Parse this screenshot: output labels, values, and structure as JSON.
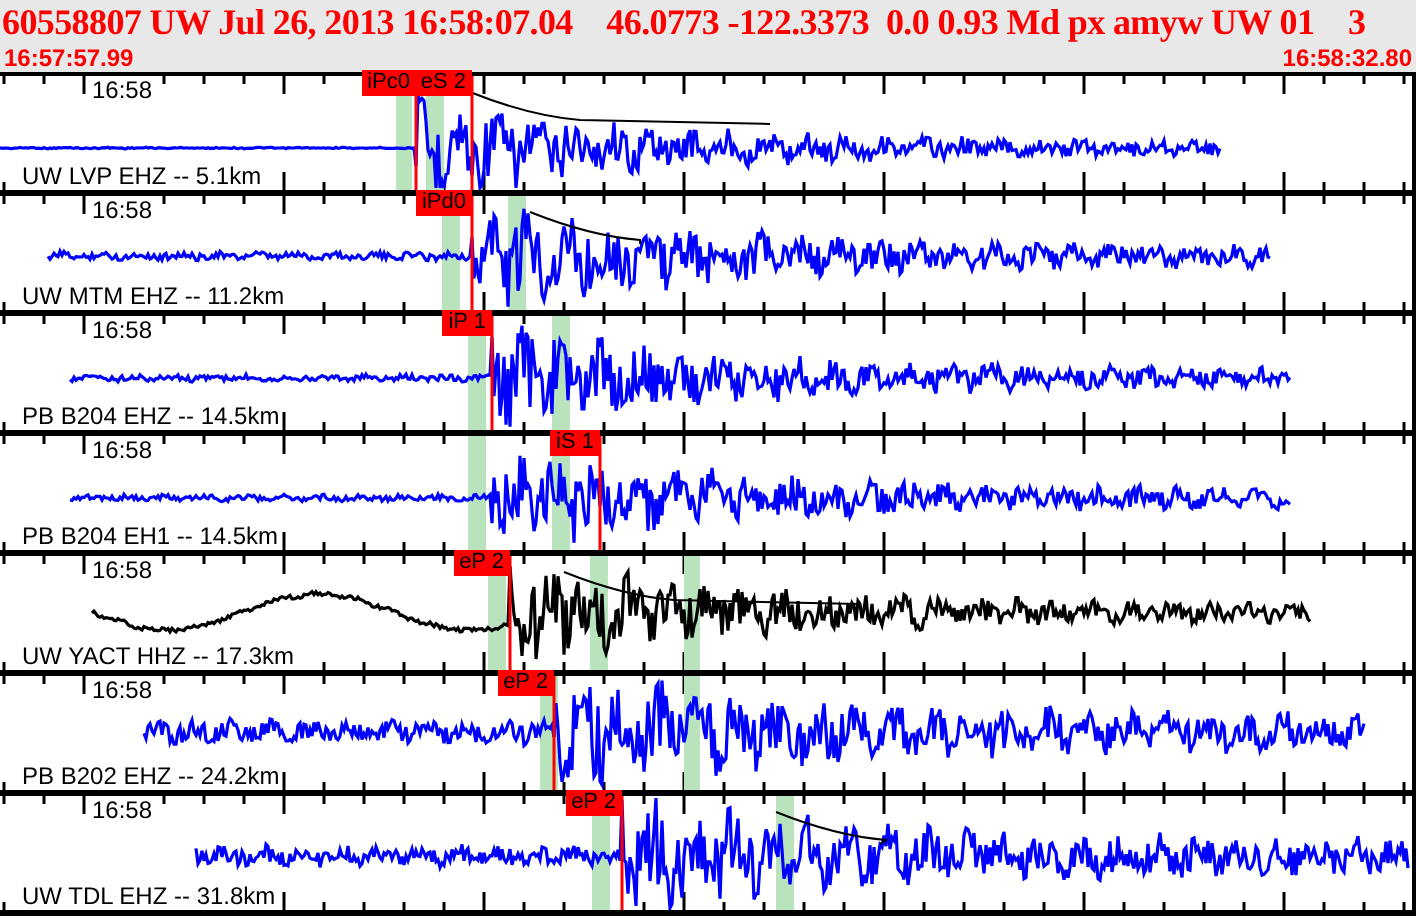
{
  "header": {
    "title": "60558807 UW Jul 26, 2013 16:58:07.04    46.0773 -122.3373  0.0 0.93 Md px amyw UW 01    3",
    "start_time": "16:57:57.99",
    "end_time": "16:58:32.80"
  },
  "traces": [
    {
      "time_label": "16:58",
      "label": "UW LVP EHZ -- 5.1km",
      "color": "#0000ff",
      "picks": [
        "iPc0",
        "eS 2"
      ]
    },
    {
      "time_label": "16:58",
      "label": "UW MTM EHZ -- 11.2km",
      "color": "#0000ff",
      "picks": [
        "iPd0"
      ]
    },
    {
      "time_label": "16:58",
      "label": "PB B204 EHZ -- 14.5km",
      "color": "#0000ff",
      "picks": [
        "iP 1"
      ]
    },
    {
      "time_label": "16:58",
      "label": "PB B204 EH1 -- 14.5km",
      "color": "#0000ff",
      "picks": [
        "iS 1"
      ]
    },
    {
      "time_label": "16:58",
      "label": "UW YACT HHZ -- 17.3km",
      "color": "#000000",
      "picks": [
        "eP 2"
      ]
    },
    {
      "time_label": "16:58",
      "label": "PB B202 EHZ -- 24.2km",
      "color": "#0000ff",
      "picks": [
        "eP 2"
      ]
    },
    {
      "time_label": "16:58",
      "label": "UW TDL EHZ -- 31.8km",
      "color": "#0000ff",
      "picks": [
        "eP 2"
      ]
    }
  ]
}
